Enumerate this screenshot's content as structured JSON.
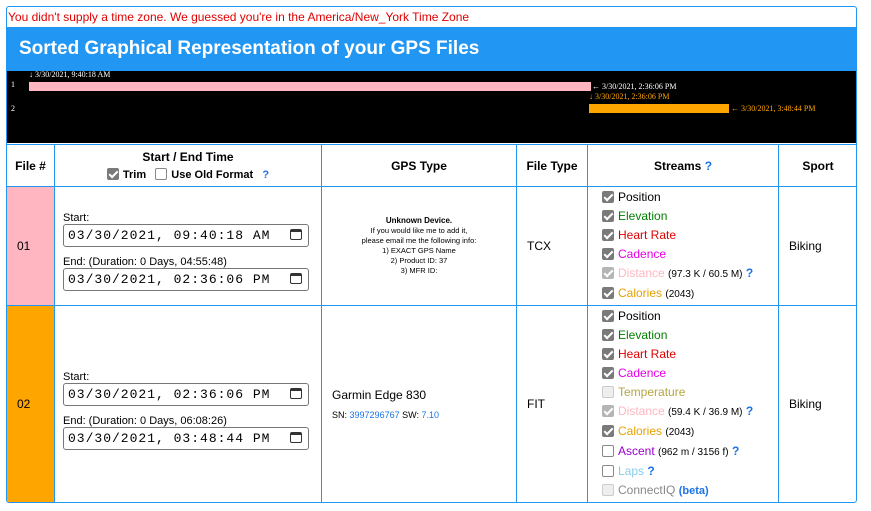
{
  "warning": "You didn't supply a time zone. We guessed you're in the America/New_York Time Zone",
  "header": {
    "title": "Sorted Graphical Representation of your GPS Files"
  },
  "timeline": {
    "row1_num": "1",
    "row2_num": "2",
    "row1_start": "3/30/2021, 9:40:18 AM",
    "row1_end": "3/30/2021, 2:36:06 PM",
    "row2_start": "3/30/2021, 2:36:06 PM",
    "row2_end": "3/30/2021, 3:48:44 PM",
    "row1_color": "#FFB6C1",
    "row2_color": "#FFA500"
  },
  "table": {
    "headers": {
      "file_num": "File #",
      "time": "Start / End Time",
      "trim": "Trim",
      "old_format": "Use Old Format",
      "help": "?",
      "gps_type": "GPS Type",
      "file_type": "File Type",
      "streams": "Streams",
      "sport": "Sport"
    },
    "rows": [
      {
        "num": "01",
        "color": "#FFB6C1",
        "start_label": "Start:",
        "start_value": "03/30/2021, 09:40:18 AM",
        "end_label": "End: (Duration: 0 Days, 04:55:48)",
        "end_value": "03/30/2021, 02:36:06 PM",
        "device_title": "Unknown Device.",
        "device_lines": [
          "If you would like me to add it,",
          "please email me the following info:",
          "1) EXACT GPS Name",
          "2) Product ID: 37",
          "3) MFR ID:"
        ],
        "file_type": "TCX",
        "sport": "Biking",
        "streams": {
          "position": "Position",
          "elevation": "Elevation",
          "heart_rate": "Heart Rate",
          "cadence": "Cadence",
          "distance": "Distance",
          "distance_detail": "(97.3 K / 60.5 M)",
          "calories": "Calories",
          "calories_detail": "(2043)"
        }
      },
      {
        "num": "02",
        "color": "#FFA500",
        "start_label": "Start:",
        "start_value": "03/30/2021, 02:36:06 PM",
        "end_label": "End: (Duration: 0 Days, 06:08:26)",
        "end_value": "03/30/2021, 03:48:44 PM",
        "device_name": "Garmin Edge 830",
        "sn_label": "SN:",
        "sn_value": "3997296767",
        "sw_label": "SW:",
        "sw_value": "7.10",
        "file_type": "FIT",
        "sport": "Biking",
        "streams": {
          "position": "Position",
          "elevation": "Elevation",
          "heart_rate": "Heart Rate",
          "cadence": "Cadence",
          "temperature": "Temperature",
          "distance": "Distance",
          "distance_detail": "(59.4 K / 36.9 M)",
          "calories": "Calories",
          "calories_detail": "(2043)",
          "ascent": "Ascent",
          "ascent_detail": "(962 m / 3156 f)",
          "laps": "Laps",
          "connectiq": "ConnectIQ",
          "beta": "(beta)"
        }
      }
    ]
  },
  "colors": {
    "accent": "#2196F3",
    "elevation": "#008000",
    "heart_rate": "#e00000",
    "cadence": "#e600e6",
    "distance": "#ffb6c1",
    "calories": "#e6a100",
    "temperature": "#b5a642",
    "ascent": "#9900cc",
    "laps": "#87ceeb"
  }
}
